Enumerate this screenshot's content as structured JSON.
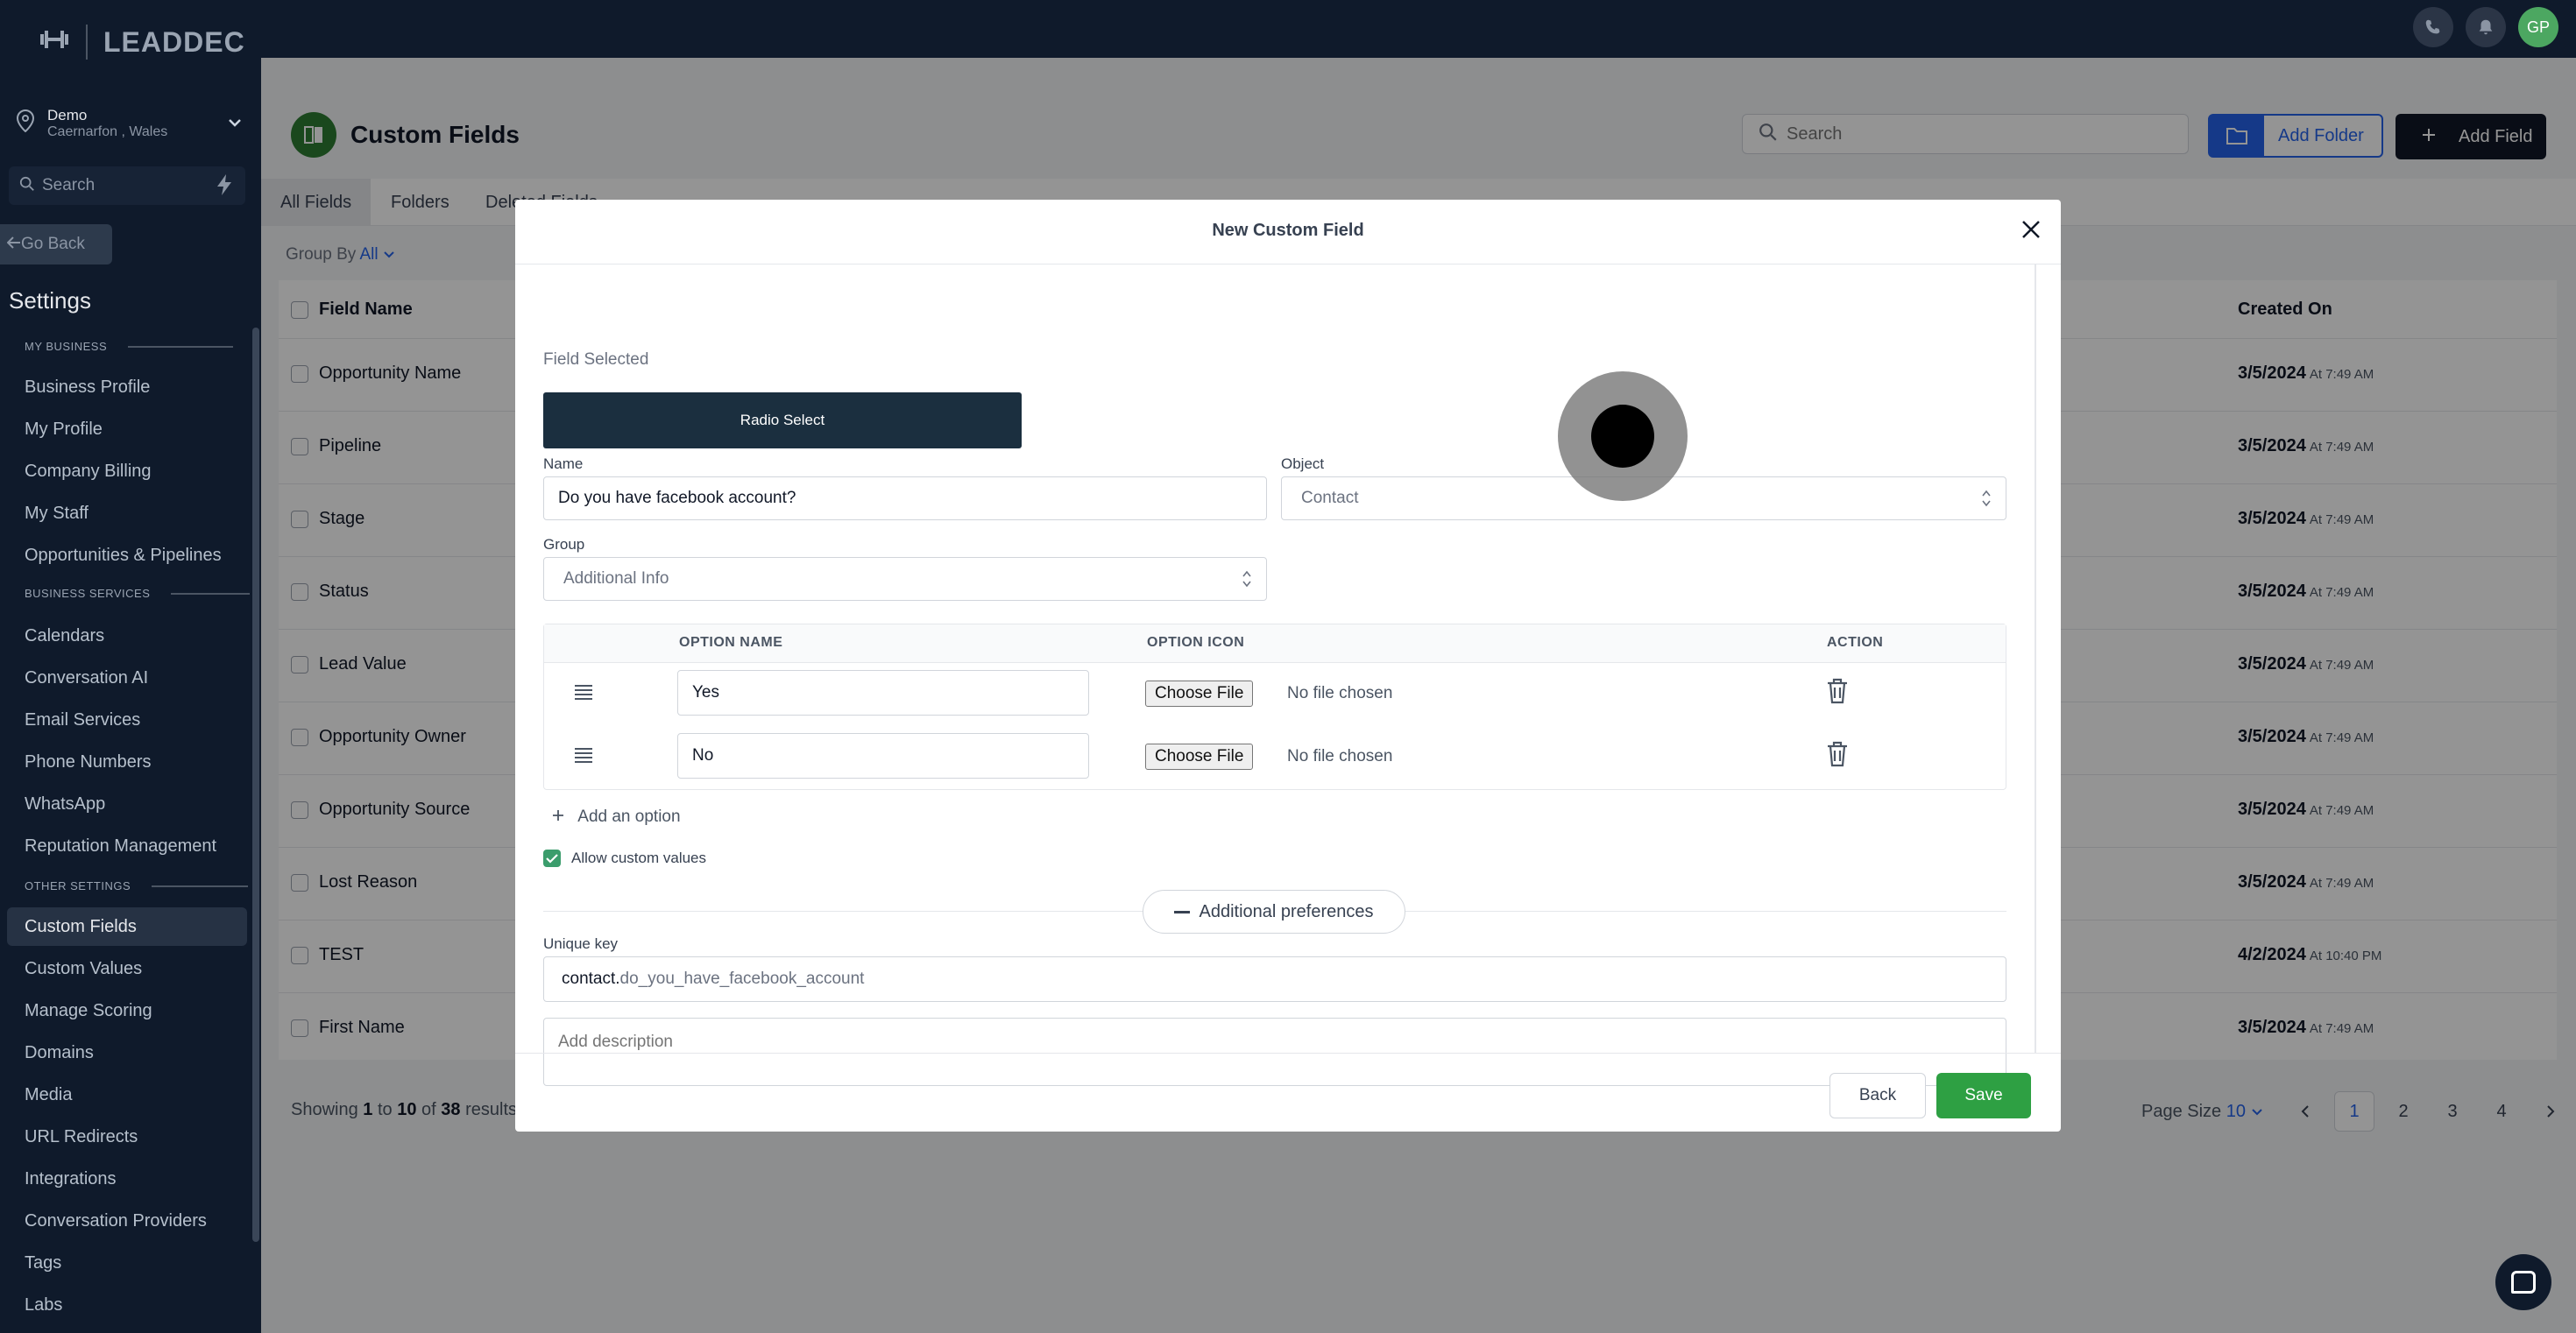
{
  "app": {
    "logo_text": "LEADDEC",
    "avatar_initials": "GP"
  },
  "location": {
    "name": "Demo",
    "address": "Caernarfon , Wales"
  },
  "sidebar": {
    "search_placeholder": "Search",
    "go_back": "Go Back",
    "title": "Settings",
    "sections": {
      "my_business": "MY BUSINESS",
      "business_services": "BUSINESS SERVICES",
      "other_settings": "OTHER SETTINGS"
    },
    "items": [
      "Business Profile",
      "My Profile",
      "Company Billing",
      "My Staff",
      "Opportunities & Pipelines",
      "Calendars",
      "Conversation AI",
      "Email Services",
      "Phone Numbers",
      "WhatsApp",
      "Reputation Management",
      "Custom Fields",
      "Custom Values",
      "Manage Scoring",
      "Domains",
      "Media",
      "URL Redirects",
      "Integrations",
      "Conversation Providers",
      "Tags",
      "Labs"
    ]
  },
  "page": {
    "title": "Custom Fields",
    "search_placeholder": "Search",
    "add_folder": "Add Folder",
    "add_field": "Add Field",
    "tabs": [
      "All Fields",
      "Folders",
      "Deleted Fields"
    ],
    "group_by_label": "Group By",
    "group_by_value": "All",
    "columns": {
      "field_name": "Field Name",
      "created_on": "Created On"
    },
    "rows": [
      {
        "name": "Opportunity Name",
        "date": "3/5/2024",
        "time": "At 7:49 AM"
      },
      {
        "name": "Pipeline",
        "date": "3/5/2024",
        "time": "At 7:49 AM"
      },
      {
        "name": "Stage",
        "date": "3/5/2024",
        "time": "At 7:49 AM"
      },
      {
        "name": "Status",
        "date": "3/5/2024",
        "time": "At 7:49 AM"
      },
      {
        "name": "Lead Value",
        "date": "3/5/2024",
        "time": "At 7:49 AM"
      },
      {
        "name": "Opportunity Owner",
        "date": "3/5/2024",
        "time": "At 7:49 AM"
      },
      {
        "name": "Opportunity Source",
        "date": "3/5/2024",
        "time": "At 7:49 AM"
      },
      {
        "name": "Lost Reason",
        "date": "3/5/2024",
        "time": "At 7:49 AM"
      },
      {
        "name": "TEST",
        "date": "4/2/2024",
        "time": "At 10:40 PM"
      },
      {
        "name": "First Name",
        "date": "3/5/2024",
        "time": "At 7:49 AM"
      }
    ],
    "showing": {
      "prefix": "Showing",
      "from": "1",
      "to_word": "to",
      "to": "10",
      "of_word": "of",
      "total": "38",
      "suffix": "results"
    },
    "page_size_label": "Page Size",
    "page_size_value": "10",
    "pages": [
      "1",
      "2",
      "3",
      "4"
    ]
  },
  "modal": {
    "title": "New Custom Field",
    "field_selected_label": "Field Selected",
    "field_type": "Radio Select",
    "name_label": "Name",
    "name_value": "Do you have facebook account?",
    "object_label": "Object",
    "object_value": "Contact",
    "group_label": "Group",
    "group_value": "Additional Info",
    "options_header": {
      "name": "OPTION NAME",
      "icon": "OPTION ICON",
      "action": "ACTION"
    },
    "options": [
      {
        "value": "Yes",
        "file_button": "Choose File",
        "file_status": "No file chosen"
      },
      {
        "value": "No",
        "file_button": "Choose File",
        "file_status": "No file chosen"
      }
    ],
    "add_option": "Add an option",
    "allow_custom": "Allow custom values",
    "additional_preferences": "Additional preferences",
    "unique_key_label": "Unique key",
    "unique_key_prefix": "contact.",
    "unique_key_value": "do_you_have_facebook_account",
    "description_placeholder": "Add description",
    "back": "Back",
    "save": "Save"
  },
  "colors": {
    "sidebar_bg": "#0f1a2b",
    "primary_blue": "#2563eb",
    "save_green": "#2ea043",
    "field_type_bg": "#1b2f3f"
  }
}
